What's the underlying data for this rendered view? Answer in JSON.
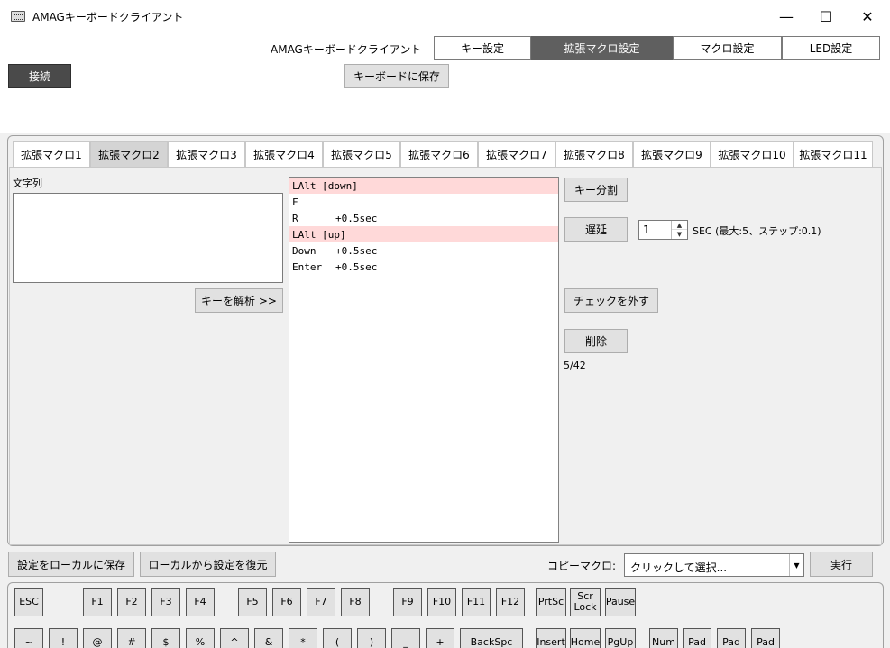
{
  "window": {
    "title": "AMAGキーボードクライアント",
    "minimize": "—",
    "maximize": "☐",
    "close": "✕"
  },
  "header": {
    "app_label": "AMAGキーボードクライアント",
    "tabs": [
      "キー設定",
      "拡張マクロ設定",
      "マクロ設定",
      "LED設定"
    ],
    "active_tab": "拡張マクロ設定",
    "connect_label": "接続",
    "save_keyboard_label": "キーボードに保存"
  },
  "subtabs": {
    "items": [
      "拡張マクロ1",
      "拡張マクロ2",
      "拡張マクロ3",
      "拡張マクロ4",
      "拡張マクロ5",
      "拡張マクロ6",
      "拡張マクロ7",
      "拡張マクロ8",
      "拡張マクロ9",
      "拡張マクロ10",
      "拡張マクロ11"
    ],
    "active": "拡張マクロ2"
  },
  "editor": {
    "string_label": "文字列",
    "string_value": "",
    "parse_label": "キーを解析 >>",
    "sequence": [
      {
        "key": "LAlt [down]",
        "delay": "",
        "highlight": true
      },
      {
        "key": "F",
        "delay": "",
        "highlight": false
      },
      {
        "key": "R",
        "delay": "+0.5sec",
        "highlight": false
      },
      {
        "key": "LAlt [up]",
        "delay": "",
        "highlight": true
      },
      {
        "key": "Down",
        "delay": "+0.5sec",
        "highlight": false
      },
      {
        "key": "Enter",
        "delay": "+0.5sec",
        "highlight": false
      }
    ],
    "split_key_label": "キー分割",
    "delay_label": "遅延",
    "delay_value": "1",
    "delay_hint": "SEC (最大:5、ステップ:0.1)",
    "uncheck_label": "チェックを外す",
    "delete_label": "削除",
    "count": "5/42"
  },
  "bottom": {
    "save_local_label": "設定をローカルに保存",
    "restore_local_label": "ローカルから設定を復元",
    "copy_macro_label": "コピーマクロ:",
    "copy_macro_value": "クリックして選択...",
    "execute_label": "実行"
  },
  "keyboard": {
    "row1": [
      "ESC",
      "F1",
      "F2",
      "F3",
      "F4",
      "F5",
      "F6",
      "F7",
      "F8",
      "F9",
      "F10",
      "F11",
      "F12",
      "PrtSc",
      "Scr\nLock",
      "Pause"
    ],
    "row2": [
      "~",
      "!",
      "@",
      "#",
      "$",
      "%",
      "^",
      "&",
      "*",
      "(",
      ")",
      "_",
      "+",
      "BackSpc",
      "Insert",
      "Home",
      "PgUp",
      "Num",
      "Pad",
      "Pad",
      "Pad"
    ]
  },
  "colors": {
    "active_tab_bg": "#5f5f5f",
    "highlight_row": "#ffd9d9",
    "connect_bg": "#4a4a4a"
  }
}
